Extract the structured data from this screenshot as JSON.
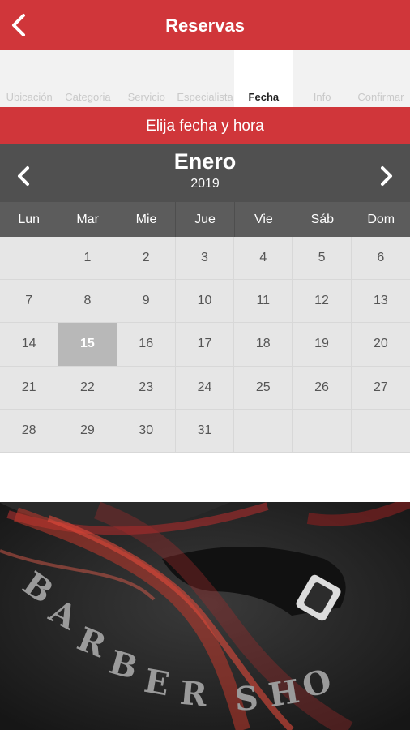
{
  "header": {
    "title": "Reservas"
  },
  "steps": [
    {
      "label": "Ubicación",
      "active": false
    },
    {
      "label": "Categoria",
      "active": false
    },
    {
      "label": "Servicio",
      "active": false
    },
    {
      "label": "Especialista",
      "active": false
    },
    {
      "label": "Fecha",
      "active": true
    },
    {
      "label": "Info",
      "active": false
    },
    {
      "label": "Confirmar",
      "active": false
    }
  ],
  "banner": {
    "text": "Elija fecha y hora"
  },
  "calendar": {
    "month": "Enero",
    "year": "2019",
    "weekdays": [
      "Lun",
      "Mar",
      "Mie",
      "Jue",
      "Vie",
      "Sáb",
      "Dom"
    ],
    "days": [
      "",
      "1",
      "2",
      "3",
      "4",
      "5",
      "6",
      "7",
      "8",
      "9",
      "10",
      "11",
      "12",
      "13",
      "14",
      "15",
      "16",
      "17",
      "18",
      "19",
      "20",
      "21",
      "22",
      "23",
      "24",
      "25",
      "26",
      "27",
      "28",
      "29",
      "30",
      "31",
      "",
      "",
      ""
    ],
    "selected_day": "15"
  },
  "colors": {
    "brand_red": "#d0363a",
    "calendar_header": "#505050",
    "selected_day_bg": "#b8b8b8"
  },
  "image": {
    "logo_text": "BARBER SHOP"
  }
}
